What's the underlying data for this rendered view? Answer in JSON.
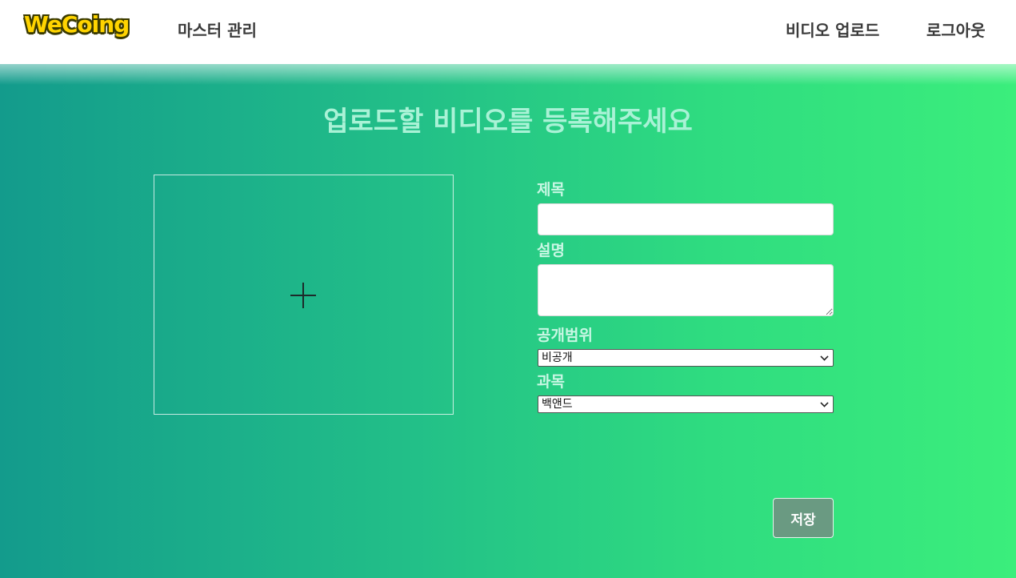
{
  "header": {
    "logo": "WeCoing",
    "nav_master": "마스터 관리",
    "nav_upload": "비디오 업로드",
    "nav_logout": "로그아웃"
  },
  "form": {
    "title": "업로드할 비디오를 등록해주세요",
    "dropzone_icon": "plus-icon",
    "title_label": "제목",
    "title_value": "",
    "description_label": "설명",
    "description_value": "",
    "scope_label": "공개범위",
    "scope_selected": "비공개",
    "subject_label": "과목",
    "subject_selected": "백앤드",
    "save_label": "저장"
  },
  "colors": {
    "gradient_start": "#139b8c",
    "gradient_end": "#3bee7c",
    "logo_yellow": "#ffd400",
    "save_button": "#6a9a82"
  }
}
